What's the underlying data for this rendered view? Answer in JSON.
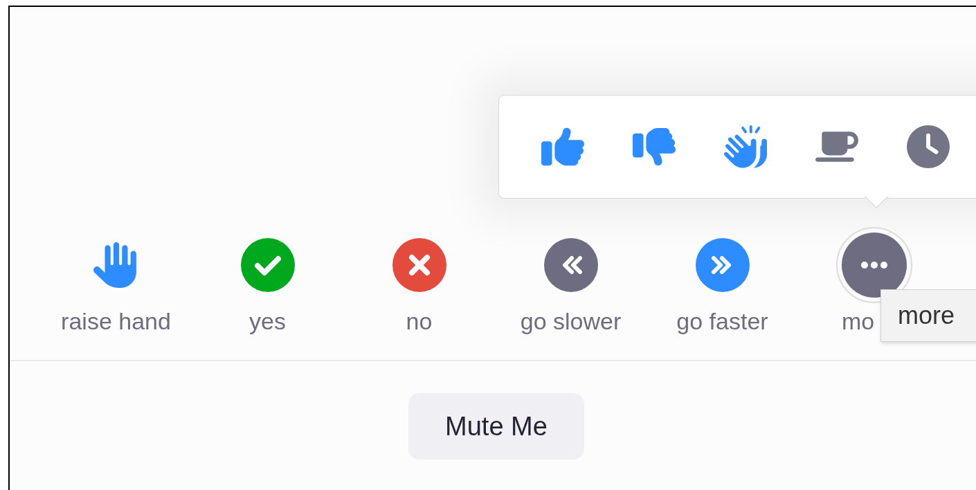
{
  "reactions_popup": {
    "items": [
      {
        "kind": "thumbs_up",
        "color": "#2d8cff"
      },
      {
        "kind": "thumbs_down",
        "color": "#2d8cff"
      },
      {
        "kind": "clap",
        "color": "#2d8cff"
      },
      {
        "kind": "coffee",
        "color": "#747487"
      },
      {
        "kind": "clock",
        "color": "#747487"
      }
    ]
  },
  "feedback": [
    {
      "kind": "raise_hand",
      "label": "raise hand",
      "color": "#2d8cff"
    },
    {
      "kind": "yes",
      "label": "yes",
      "color": "#00a81e"
    },
    {
      "kind": "no",
      "label": "no",
      "color": "#e34b3c"
    },
    {
      "kind": "slower",
      "label": "go slower",
      "color": "#6e6c80"
    },
    {
      "kind": "faster",
      "label": "go faster",
      "color": "#2d8cff"
    },
    {
      "kind": "more",
      "label": "mo",
      "color": "#6e6c80"
    }
  ],
  "tooltip": {
    "text": "more"
  },
  "mute_button": {
    "label": "Mute Me"
  }
}
